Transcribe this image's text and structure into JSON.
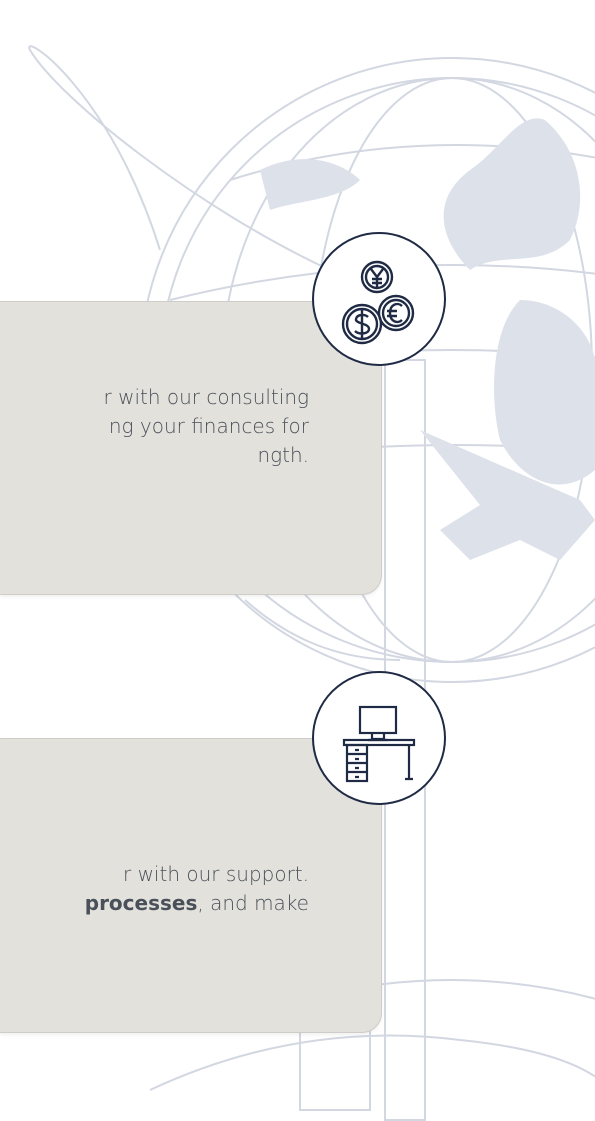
{
  "colors": {
    "card_background": "#e2e1dc",
    "text": "#4a5059",
    "icon_outline": "#1f2a44",
    "globe": "#c9cfdb"
  },
  "background": {
    "icon": "globe-illustration"
  },
  "services": [
    {
      "icon": "currency-coins-icon",
      "line1": "r with our consulting",
      "line2": "ng your finances for",
      "line3": "ngth."
    },
    {
      "icon": "office-desk-icon",
      "line1": "r with our support.",
      "line2_bold": "processes",
      "line2_rest": ", and make"
    }
  ]
}
